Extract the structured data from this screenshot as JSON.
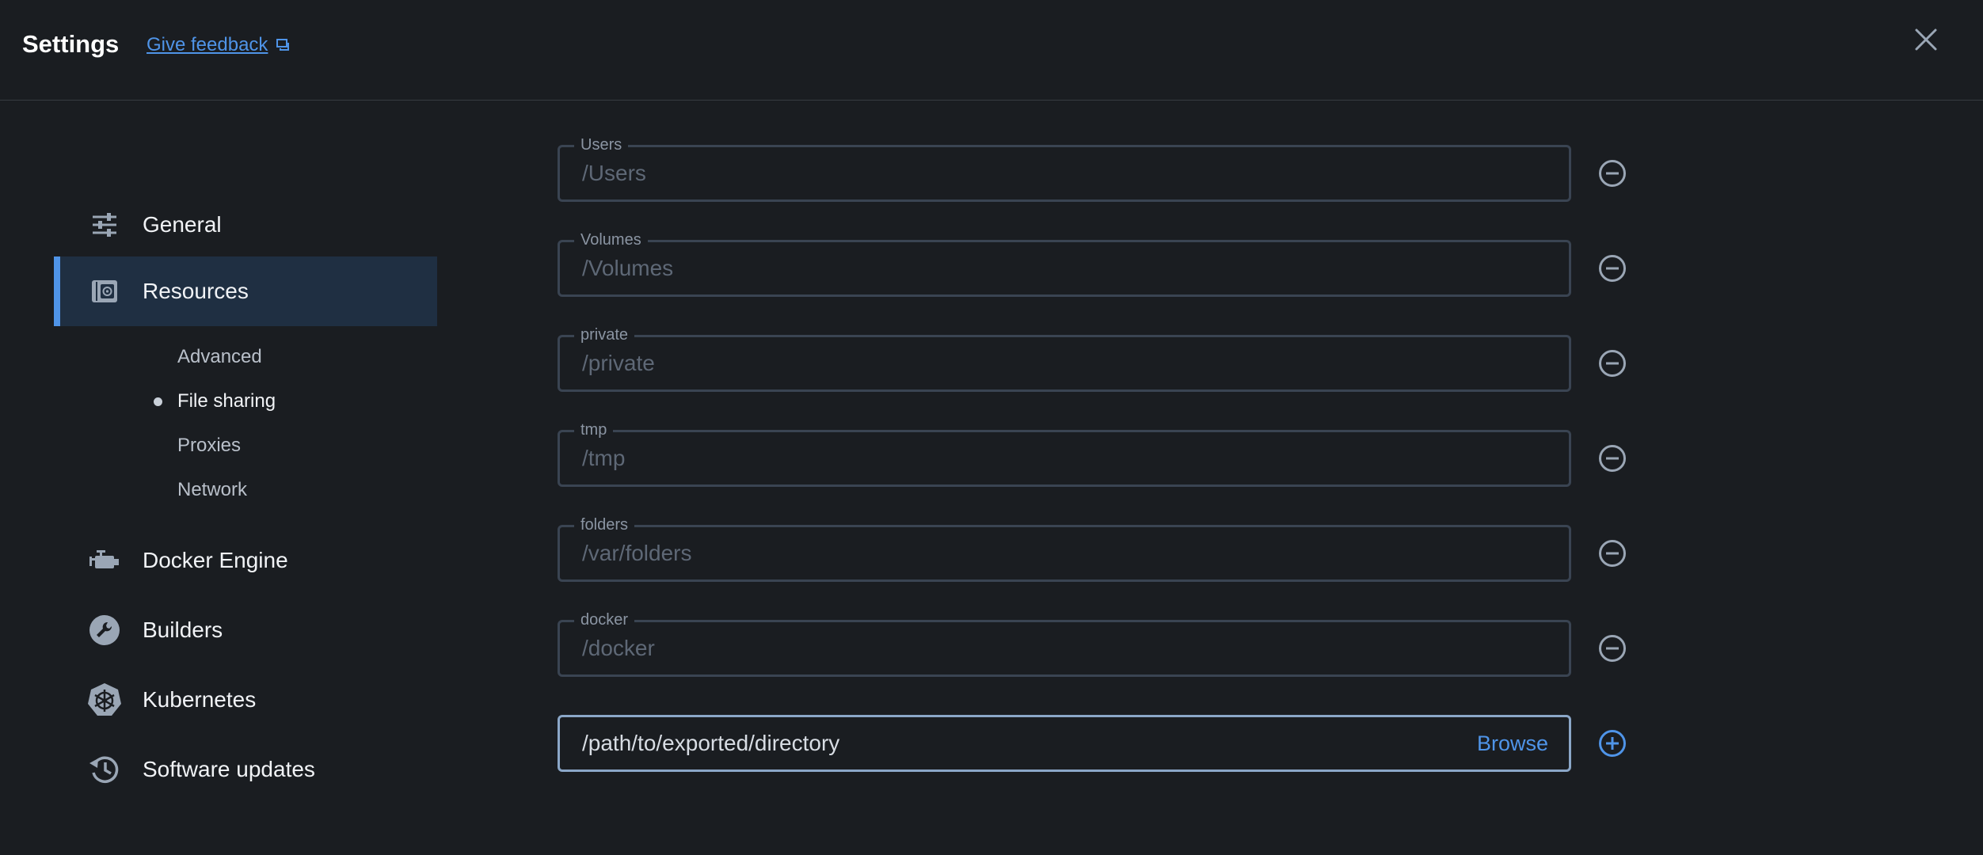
{
  "header": {
    "title": "Settings",
    "feedback_label": "Give feedback"
  },
  "sidebar": {
    "items": [
      {
        "label": "General",
        "icon": "sliders-icon"
      },
      {
        "label": "Resources",
        "icon": "resources-icon",
        "active": true
      },
      {
        "label": "Docker Engine",
        "icon": "engine-icon"
      },
      {
        "label": "Builders",
        "icon": "wrench-icon"
      },
      {
        "label": "Kubernetes",
        "icon": "helm-icon"
      },
      {
        "label": "Software updates",
        "icon": "history-icon"
      }
    ],
    "sub_items": [
      {
        "label": "Advanced"
      },
      {
        "label": "File sharing",
        "current": true
      },
      {
        "label": "Proxies"
      },
      {
        "label": "Network"
      }
    ]
  },
  "file_sharing": {
    "paths": [
      {
        "name": "Users",
        "path": "/Users"
      },
      {
        "name": "Volumes",
        "path": "/Volumes"
      },
      {
        "name": "private",
        "path": "/private"
      },
      {
        "name": "tmp",
        "path": "/tmp"
      },
      {
        "name": "folders",
        "path": "/var/folders"
      },
      {
        "name": "docker",
        "path": "/docker"
      }
    ],
    "new_path_value": "/path/to/exported/directory",
    "browse_label": "Browse"
  },
  "colors": {
    "background": "#1a1d21",
    "accent": "#4f94e8",
    "active_nav_bg": "#1f2f42",
    "field_border": "#3a4452",
    "icon_gray": "#9aa6b5"
  }
}
